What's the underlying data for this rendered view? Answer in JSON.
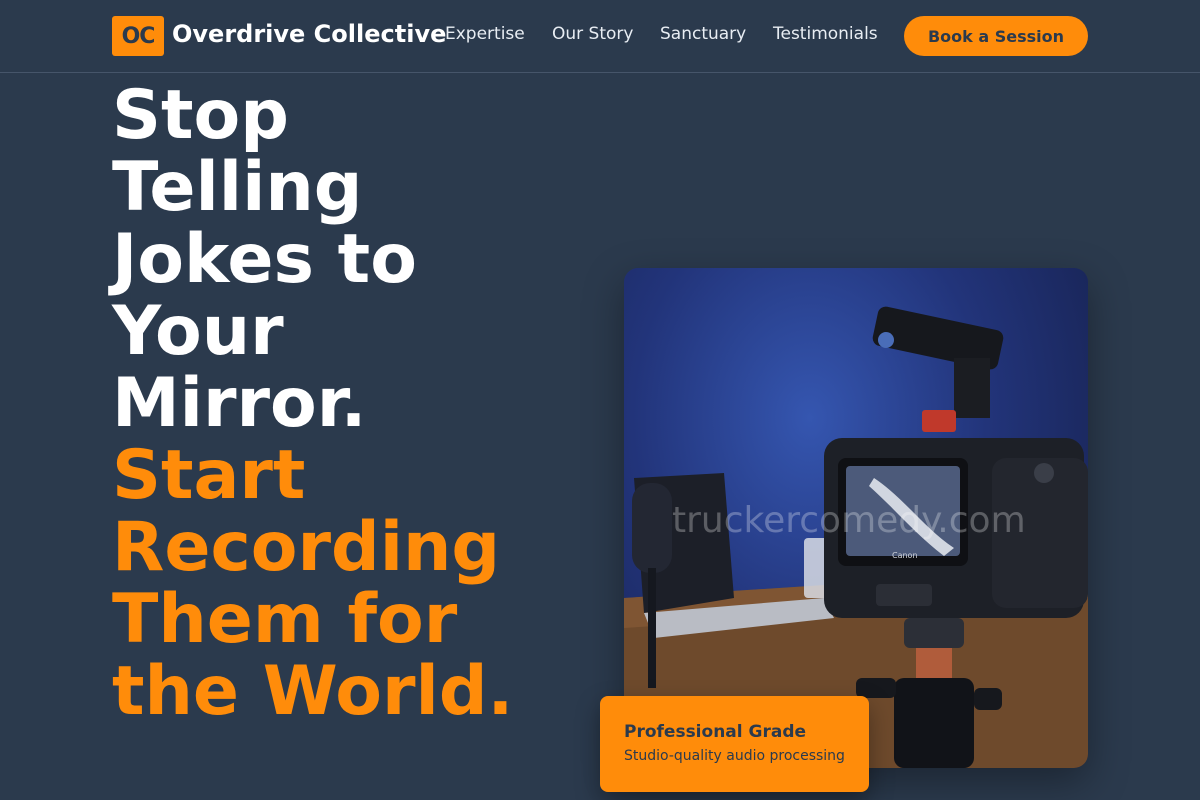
{
  "header": {
    "logo_text": "OC",
    "brand": "Overdrive Collective",
    "nav": [
      {
        "label": "Expertise"
      },
      {
        "label": "Our Story"
      },
      {
        "label": "Sanctuary"
      },
      {
        "label": "Testimonials"
      }
    ],
    "cta_label": "Book a Session"
  },
  "hero": {
    "headline_white": [
      "Stop",
      "Telling",
      "Jokes to",
      "Your",
      "Mirror."
    ],
    "headline_orange": [
      "Start",
      "Recording",
      "Them for",
      "the World."
    ]
  },
  "image": {
    "watermark": "truckercomedy.com",
    "camera_brand": "Canon"
  },
  "card": {
    "title": "Professional Grade",
    "subtitle": "Studio-quality audio processing"
  },
  "colors": {
    "background": "#2b3a4d",
    "accent": "#ff8c0a",
    "text": "#ffffff"
  }
}
